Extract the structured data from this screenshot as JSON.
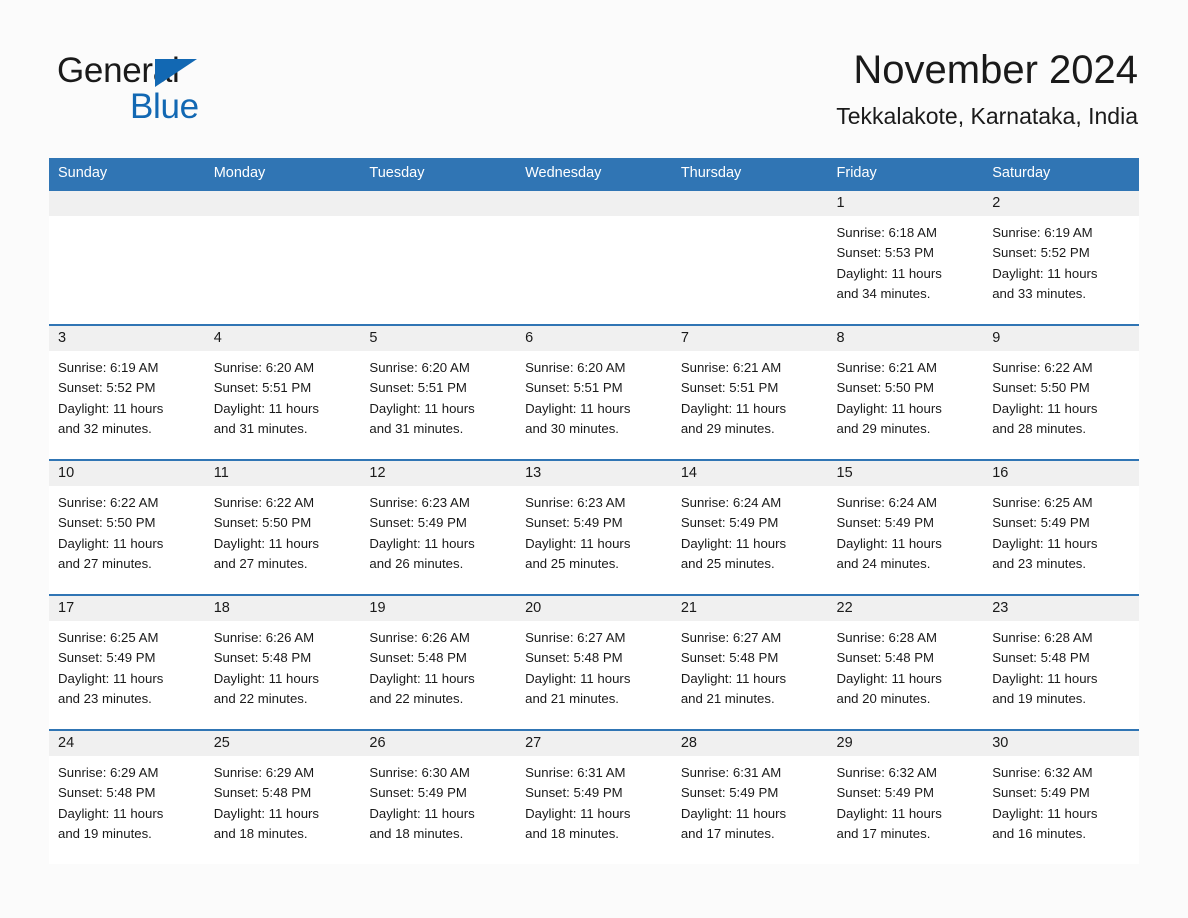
{
  "brand": {
    "line1": "General",
    "line2": "Blue",
    "mark": "triangle-icon",
    "accent_color": "#1268b3"
  },
  "header": {
    "title": "November 2024",
    "subtitle": "Tekkalakote, Karnataka, India"
  },
  "calendar": {
    "header_bg": "#3075b4",
    "daynum_bg": "#f0f0f0",
    "weekday_headers": [
      "Sunday",
      "Monday",
      "Tuesday",
      "Wednesday",
      "Thursday",
      "Friday",
      "Saturday"
    ],
    "labels": {
      "sunrise": "Sunrise:",
      "sunset": "Sunset:",
      "daylight": "Daylight:"
    },
    "weeks": [
      [
        {
          "day": "",
          "lines": []
        },
        {
          "day": "",
          "lines": []
        },
        {
          "day": "",
          "lines": []
        },
        {
          "day": "",
          "lines": []
        },
        {
          "day": "",
          "lines": []
        },
        {
          "day": "1",
          "lines": [
            "Sunrise: 6:18 AM",
            "Sunset: 5:53 PM",
            "Daylight: 11 hours",
            "and 34 minutes."
          ]
        },
        {
          "day": "2",
          "lines": [
            "Sunrise: 6:19 AM",
            "Sunset: 5:52 PM",
            "Daylight: 11 hours",
            "and 33 minutes."
          ]
        }
      ],
      [
        {
          "day": "3",
          "lines": [
            "Sunrise: 6:19 AM",
            "Sunset: 5:52 PM",
            "Daylight: 11 hours",
            "and 32 minutes."
          ]
        },
        {
          "day": "4",
          "lines": [
            "Sunrise: 6:20 AM",
            "Sunset: 5:51 PM",
            "Daylight: 11 hours",
            "and 31 minutes."
          ]
        },
        {
          "day": "5",
          "lines": [
            "Sunrise: 6:20 AM",
            "Sunset: 5:51 PM",
            "Daylight: 11 hours",
            "and 31 minutes."
          ]
        },
        {
          "day": "6",
          "lines": [
            "Sunrise: 6:20 AM",
            "Sunset: 5:51 PM",
            "Daylight: 11 hours",
            "and 30 minutes."
          ]
        },
        {
          "day": "7",
          "lines": [
            "Sunrise: 6:21 AM",
            "Sunset: 5:51 PM",
            "Daylight: 11 hours",
            "and 29 minutes."
          ]
        },
        {
          "day": "8",
          "lines": [
            "Sunrise: 6:21 AM",
            "Sunset: 5:50 PM",
            "Daylight: 11 hours",
            "and 29 minutes."
          ]
        },
        {
          "day": "9",
          "lines": [
            "Sunrise: 6:22 AM",
            "Sunset: 5:50 PM",
            "Daylight: 11 hours",
            "and 28 minutes."
          ]
        }
      ],
      [
        {
          "day": "10",
          "lines": [
            "Sunrise: 6:22 AM",
            "Sunset: 5:50 PM",
            "Daylight: 11 hours",
            "and 27 minutes."
          ]
        },
        {
          "day": "11",
          "lines": [
            "Sunrise: 6:22 AM",
            "Sunset: 5:50 PM",
            "Daylight: 11 hours",
            "and 27 minutes."
          ]
        },
        {
          "day": "12",
          "lines": [
            "Sunrise: 6:23 AM",
            "Sunset: 5:49 PM",
            "Daylight: 11 hours",
            "and 26 minutes."
          ]
        },
        {
          "day": "13",
          "lines": [
            "Sunrise: 6:23 AM",
            "Sunset: 5:49 PM",
            "Daylight: 11 hours",
            "and 25 minutes."
          ]
        },
        {
          "day": "14",
          "lines": [
            "Sunrise: 6:24 AM",
            "Sunset: 5:49 PM",
            "Daylight: 11 hours",
            "and 25 minutes."
          ]
        },
        {
          "day": "15",
          "lines": [
            "Sunrise: 6:24 AM",
            "Sunset: 5:49 PM",
            "Daylight: 11 hours",
            "and 24 minutes."
          ]
        },
        {
          "day": "16",
          "lines": [
            "Sunrise: 6:25 AM",
            "Sunset: 5:49 PM",
            "Daylight: 11 hours",
            "and 23 minutes."
          ]
        }
      ],
      [
        {
          "day": "17",
          "lines": [
            "Sunrise: 6:25 AM",
            "Sunset: 5:49 PM",
            "Daylight: 11 hours",
            "and 23 minutes."
          ]
        },
        {
          "day": "18",
          "lines": [
            "Sunrise: 6:26 AM",
            "Sunset: 5:48 PM",
            "Daylight: 11 hours",
            "and 22 minutes."
          ]
        },
        {
          "day": "19",
          "lines": [
            "Sunrise: 6:26 AM",
            "Sunset: 5:48 PM",
            "Daylight: 11 hours",
            "and 22 minutes."
          ]
        },
        {
          "day": "20",
          "lines": [
            "Sunrise: 6:27 AM",
            "Sunset: 5:48 PM",
            "Daylight: 11 hours",
            "and 21 minutes."
          ]
        },
        {
          "day": "21",
          "lines": [
            "Sunrise: 6:27 AM",
            "Sunset: 5:48 PM",
            "Daylight: 11 hours",
            "and 21 minutes."
          ]
        },
        {
          "day": "22",
          "lines": [
            "Sunrise: 6:28 AM",
            "Sunset: 5:48 PM",
            "Daylight: 11 hours",
            "and 20 minutes."
          ]
        },
        {
          "day": "23",
          "lines": [
            "Sunrise: 6:28 AM",
            "Sunset: 5:48 PM",
            "Daylight: 11 hours",
            "and 19 minutes."
          ]
        }
      ],
      [
        {
          "day": "24",
          "lines": [
            "Sunrise: 6:29 AM",
            "Sunset: 5:48 PM",
            "Daylight: 11 hours",
            "and 19 minutes."
          ]
        },
        {
          "day": "25",
          "lines": [
            "Sunrise: 6:29 AM",
            "Sunset: 5:48 PM",
            "Daylight: 11 hours",
            "and 18 minutes."
          ]
        },
        {
          "day": "26",
          "lines": [
            "Sunrise: 6:30 AM",
            "Sunset: 5:49 PM",
            "Daylight: 11 hours",
            "and 18 minutes."
          ]
        },
        {
          "day": "27",
          "lines": [
            "Sunrise: 6:31 AM",
            "Sunset: 5:49 PM",
            "Daylight: 11 hours",
            "and 18 minutes."
          ]
        },
        {
          "day": "28",
          "lines": [
            "Sunrise: 6:31 AM",
            "Sunset: 5:49 PM",
            "Daylight: 11 hours",
            "and 17 minutes."
          ]
        },
        {
          "day": "29",
          "lines": [
            "Sunrise: 6:32 AM",
            "Sunset: 5:49 PM",
            "Daylight: 11 hours",
            "and 17 minutes."
          ]
        },
        {
          "day": "30",
          "lines": [
            "Sunrise: 6:32 AM",
            "Sunset: 5:49 PM",
            "Daylight: 11 hours",
            "and 16 minutes."
          ]
        }
      ]
    ]
  }
}
